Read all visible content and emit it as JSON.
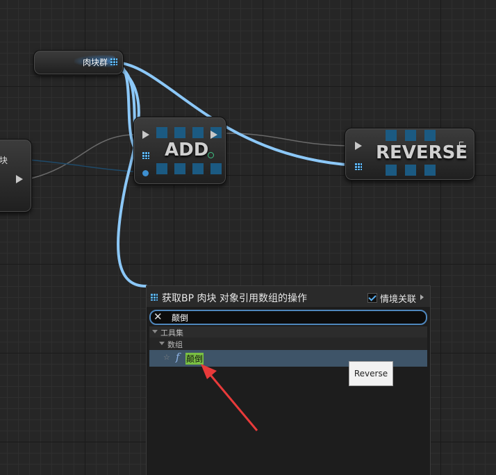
{
  "nodes": {
    "getter": {
      "label": "肉块群"
    },
    "left_partial": {
      "label": "块"
    },
    "add": {
      "title": "ADD"
    },
    "reverse": {
      "title": "REVERSE"
    }
  },
  "action_menu": {
    "title": "获取BP 肉块 对象引用数组的操作",
    "context_sensitive_label": "情境关联",
    "context_sensitive_checked": true,
    "search": {
      "value": "颠倒"
    },
    "categories": [
      {
        "label": "工具集"
      },
      {
        "label": "数组"
      }
    ],
    "result": {
      "label": "颠倒"
    }
  },
  "tooltip": {
    "text": "Reverse"
  },
  "colors": {
    "wire_blue": "#8cc8f8",
    "pin_blue": "#5cb4f2",
    "highlight_green": "#7ac043",
    "arrow_red": "#e83a3a"
  },
  "icons": [
    "array-grid-icon",
    "exec-pin-icon",
    "close-icon",
    "star-icon",
    "function-icon",
    "checkbox-icon",
    "chevron-right-icon"
  ]
}
